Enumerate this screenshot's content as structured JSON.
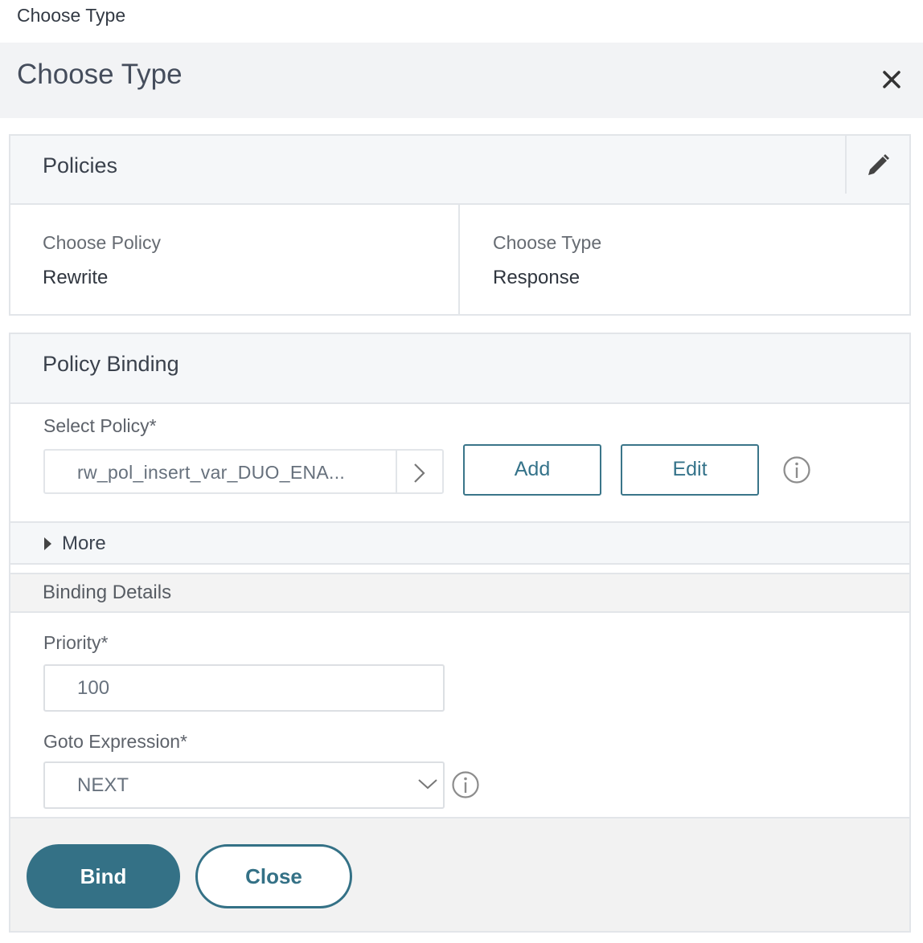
{
  "window": {
    "title": "Choose Type"
  },
  "dialog": {
    "title": "Choose Type",
    "close_icon": "close-icon"
  },
  "policies": {
    "title": "Policies",
    "edit_icon": "pencil-icon",
    "choose_policy_label": "Choose Policy",
    "choose_policy_value": "Rewrite",
    "choose_type_label": "Choose Type",
    "choose_type_value": "Response"
  },
  "policy_binding": {
    "title": "Policy Binding",
    "select_policy_label": "Select Policy*",
    "select_policy_value": "rw_pol_insert_var_DUO_ENA...",
    "add_label": "Add",
    "edit_label": "Edit",
    "more_label": "More",
    "binding_details_title": "Binding Details",
    "priority_label": "Priority*",
    "priority_value": "100",
    "goto_label": "Goto Expression*",
    "goto_value": "NEXT"
  },
  "footer": {
    "bind_label": "Bind",
    "close_label": "Close"
  },
  "colors": {
    "accent": "#347186",
    "header_bg": "#f2f3f5",
    "panel_head_bg": "#f5f7f9",
    "border": "#e2e5e9"
  }
}
